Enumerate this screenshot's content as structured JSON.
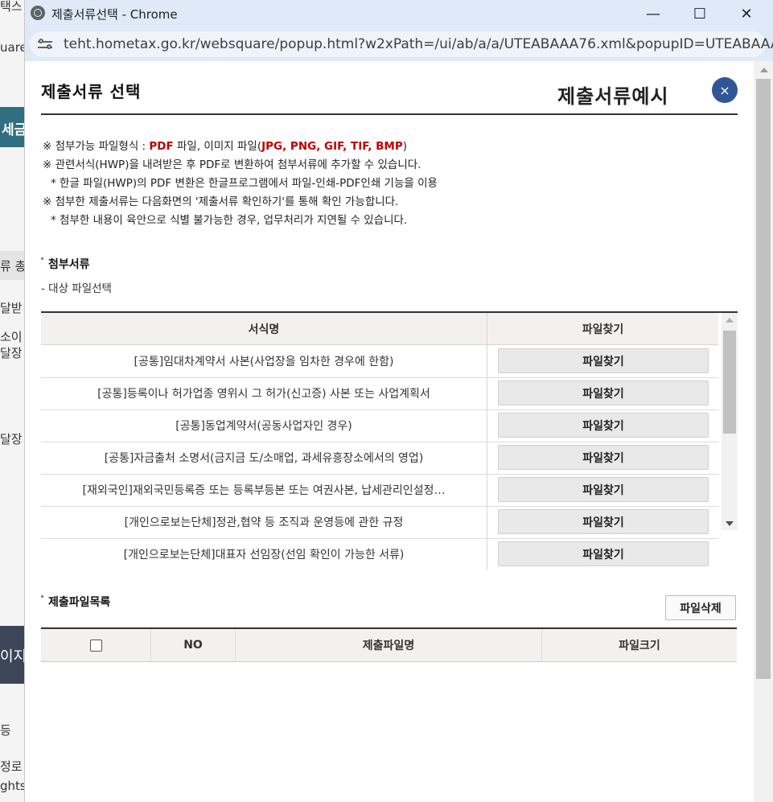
{
  "background": {
    "fragments": [
      "택스 -",
      "uare",
      "세금",
      "류 총",
      "달받",
      "소이",
      "달장",
      "달장",
      "이지",
      "등",
      "정로 &",
      "ghts"
    ]
  },
  "window": {
    "title": "제출서류선택 - Chrome",
    "minimize": "—",
    "maximize": "☐",
    "close": "✕",
    "url": "teht.hometax.go.kr/websquare/popup.html?w2xPath=/ui/ab/a/a/UTEABAAA76.xml&popupID=UTEABAAA7..."
  },
  "popup": {
    "title": "제출서류 선택",
    "sample_link": "제출서류예시",
    "close_glyph": "×"
  },
  "notice": {
    "line1_prefix": "※ 첨부가능 파일형식 : ",
    "line1_pdf": "PDF",
    "line1_mid": " 파일, 이미지 파일(",
    "line1_img": "JPG, PNG, GIF, TIF, BMP",
    "line1_suffix": ")",
    "line2": "※ 관련서식(HWP)을 내려받은 후 PDF로 변환하여 첨부서류에 추가할 수 있습니다.",
    "line3": "* 한글 파일(HWP)의 PDF 변환은 한글프로그램에서 파일-인쇄-PDF인쇄 기능을 이용",
    "line4": "※ 첨부한 제출서류는 다음화면의 '제출서류 확인하기'를 통해 확인 가능합니다.",
    "line5": "* 첨부한 내용이 육안으로 식별 불가능한 경우, 업무처리가 지연될 수 있습니다."
  },
  "attach": {
    "section_title": "첨부서류",
    "sub_title": "- 대상 파일선택",
    "col_name": "서식명",
    "col_find": "파일찾기",
    "rows": [
      {
        "name": "[공통]임대차계약서 사본(사업장을 임차한 경우에 한함)",
        "button": "파일찾기"
      },
      {
        "name": "[공통]등록이나 허가업종 영위시 그 허가(신고증) 사본 또는 사업계획서",
        "button": "파일찾기"
      },
      {
        "name": "[공통]동업계약서(공동사업자인 경우)",
        "button": "파일찾기"
      },
      {
        "name": "[공통]자금출처 소명서(금지금 도/소매업, 과세유흥장소에서의 영업)",
        "button": "파일찾기"
      },
      {
        "name": "[재외국인]재외국민등록증 또는 등록부등본 또는 여권사본, 납세관리인설정…",
        "button": "파일찾기"
      },
      {
        "name": "[개인으로보는단체]정관,협약 등 조직과 운영등에 관한 규정",
        "button": "파일찾기"
      },
      {
        "name": "[개인으로보는단체]대표자 선임장(선임 확인이 가능한 서류)",
        "button": "파일찾기"
      }
    ]
  },
  "files": {
    "section_title": "제출파일목록",
    "delete_button": "파일삭제",
    "col_no": "NO",
    "col_name": "제출파일명",
    "col_size": "파일크기"
  }
}
